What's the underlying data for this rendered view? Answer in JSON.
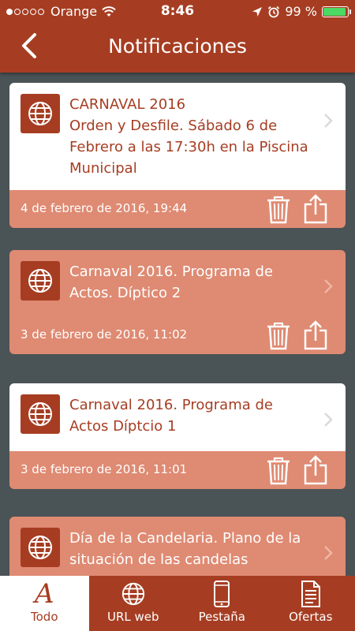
{
  "status_bar": {
    "carrier": "Orange",
    "time": "8:46",
    "battery": "99 %"
  },
  "header": {
    "title": "Notificaciones"
  },
  "notifications": [
    {
      "title": "CARNAVAL 2016",
      "body": "Orden y Desfile. Sábado 6 de Febrero a las 17:30h en la Piscina Municipal",
      "date": "4 de febrero de 2016, 19:44",
      "unread": true
    },
    {
      "title": "Carnaval 2016. Programa de Actos. Díptico 2",
      "body": "",
      "date": "3 de febrero de 2016, 11:02",
      "unread": false
    },
    {
      "title": "Carnaval 2016. Programa de Actos Díptcio 1",
      "body": "",
      "date": "3 de febrero de 2016, 11:01",
      "unread": true
    },
    {
      "title": "Día de la Candelaria. Plano de la situación de las candelas",
      "body": "",
      "date": "",
      "unread": false
    }
  ],
  "tabbar": {
    "tabs": [
      {
        "label": "Todo",
        "icon": "letter-a-icon",
        "active": true
      },
      {
        "label": "URL web",
        "icon": "globe-icon",
        "active": false
      },
      {
        "label": "Pestaña",
        "icon": "phone-icon",
        "active": false
      },
      {
        "label": "Ofertas",
        "icon": "document-icon",
        "active": false
      }
    ]
  },
  "colors": {
    "brand": "#a63d22",
    "card_footer": "#df8a72",
    "background": "#4a5356"
  }
}
